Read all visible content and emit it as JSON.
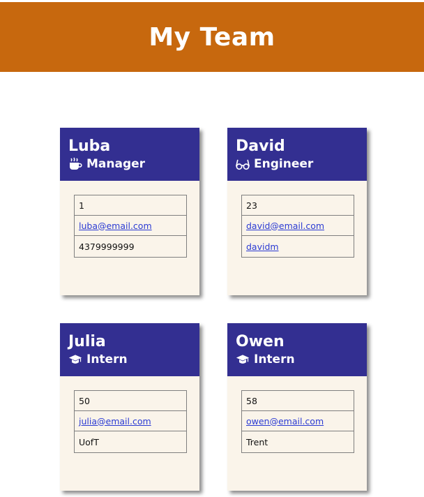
{
  "header": {
    "title": "My Team"
  },
  "colors": {
    "banner": "#c7680e",
    "card_header": "#332f91",
    "card_body": "#faf4ea",
    "link": "#2a3ad3"
  },
  "members": [
    {
      "name": "Luba",
      "role": "Manager",
      "icon": "coffee-icon",
      "id": "1",
      "email": "luba@email.com",
      "extra": "4379999999",
      "extra_is_link": false
    },
    {
      "name": "David",
      "role": "Engineer",
      "icon": "glasses-icon",
      "id": "23",
      "email": "david@email.com",
      "extra": "davidm",
      "extra_is_link": true
    },
    {
      "name": "Julia",
      "role": "Intern",
      "icon": "graduation-cap-icon",
      "id": "50",
      "email": "julia@email.com",
      "extra": "UofT",
      "extra_is_link": false
    },
    {
      "name": "Owen",
      "role": "Intern",
      "icon": "graduation-cap-icon",
      "id": "58",
      "email": "owen@email.com",
      "extra": "Trent",
      "extra_is_link": false
    }
  ]
}
